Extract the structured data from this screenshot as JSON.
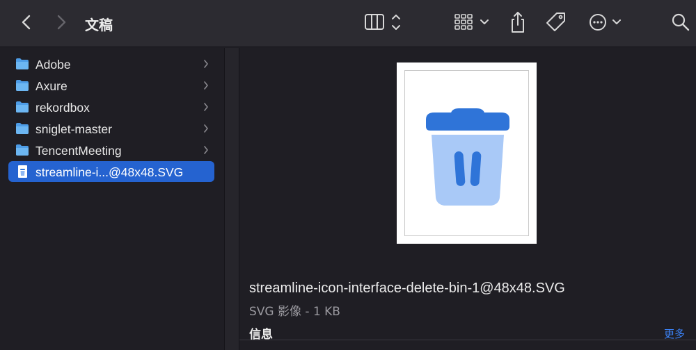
{
  "toolbar": {
    "title": "文稿",
    "icons": [
      "chevron-left-icon",
      "chevron-right-icon",
      "columns-view-icon",
      "grid-view-icon",
      "share-icon",
      "tag-icon",
      "ellipsis-circle-icon",
      "search-icon"
    ]
  },
  "sidebar": {
    "items": [
      {
        "label": "Adobe",
        "icon": "folder-icon"
      },
      {
        "label": "Axure",
        "icon": "folder-icon"
      },
      {
        "label": "rekordbox",
        "icon": "folder-icon"
      },
      {
        "label": "sniglet-master",
        "icon": "folder-icon"
      },
      {
        "label": "TencentMeeting",
        "icon": "folder-icon"
      },
      {
        "label": "streamline-i...@48x48.SVG",
        "icon": "svg-file-icon",
        "selected": true
      }
    ]
  },
  "preview": {
    "file_name": "streamline-icon-interface-delete-bin-1@48x48.SVG",
    "meta": "SVG 影像 - 1 KB",
    "info_label": "信息",
    "more_label": "更多",
    "thumbnail_icon": "trash-bin-icon"
  },
  "colors": {
    "accent": "#2563d0",
    "link": "#3b82f6",
    "folder": "#5aa9ec",
    "bin_dark": "#2f74d8",
    "bin_light": "#a9c9f7"
  }
}
